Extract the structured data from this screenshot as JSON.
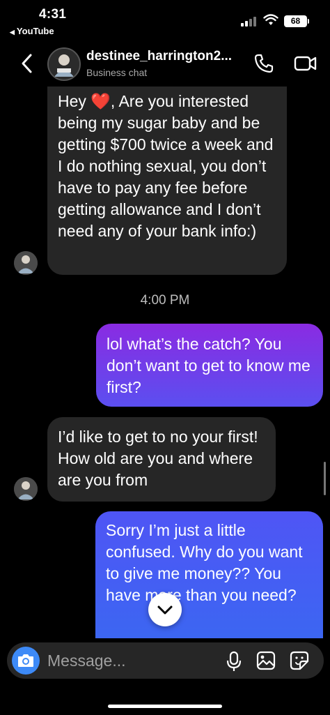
{
  "status_bar": {
    "time": "4:31",
    "back_app": "YouTube",
    "battery": "68"
  },
  "header": {
    "contact_name": "destinee_harrington2...",
    "subtitle": "Business chat"
  },
  "messages": [
    {
      "from": "them",
      "text": "Hey ❤️, Are you interested being my sugar baby and be getting $700 twice a week and I do nothing sexual, you don’t have to pay any fee before getting allowance and I don’t need any of your bank info:)"
    },
    {
      "from": "me",
      "text": "lol what’s the catch? You don’t want to get to know me first?"
    },
    {
      "from": "them",
      "text": "I’d like to get to no your first! How old are you and where are you from"
    },
    {
      "from": "me",
      "text": "Sorry I’m just a little confused. Why do you want to give me money?? You have more than you need?"
    }
  ],
  "timestamp": "4:00 PM",
  "composer": {
    "placeholder": "Message..."
  },
  "colors": {
    "incoming_bubble": "#262626",
    "outgoing_gradient_top": "#8a2be2",
    "outgoing_gradient_bottom": "#3c66f2",
    "camera_button": "#3d8af7"
  },
  "icons": [
    "back-icon",
    "phone-icon",
    "video-camera-icon",
    "camera-icon",
    "microphone-icon",
    "gallery-icon",
    "sticker-icon",
    "chevron-down-icon"
  ]
}
